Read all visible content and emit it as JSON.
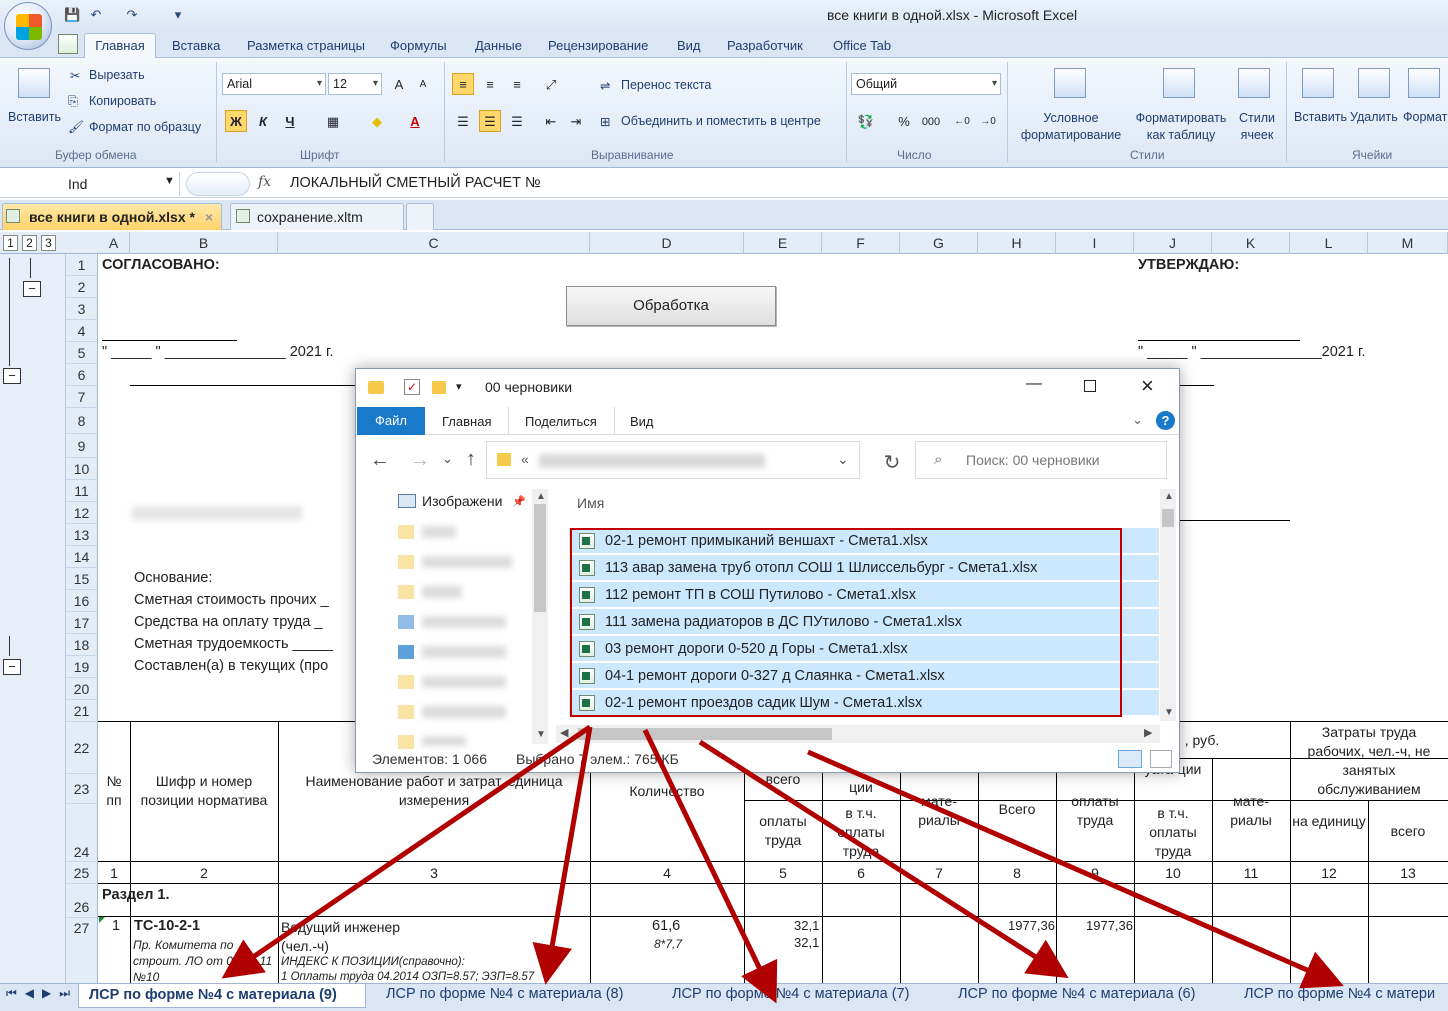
{
  "window_title": "все книги в одной.xlsx - Microsoft Excel",
  "ribbon_tabs": [
    "Главная",
    "Вставка",
    "Разметка страницы",
    "Формулы",
    "Данные",
    "Рецензирование",
    "Вид",
    "Разработчик",
    "Office Tab"
  ],
  "clipboard": {
    "paste": "Вставить",
    "cut": "Вырезать",
    "copy": "Копировать",
    "format_painter": "Формат по образцу",
    "label": "Буфер обмена"
  },
  "font": {
    "name": "Arial",
    "size": "12",
    "bold": "Ж",
    "italic": "К",
    "underline": "Ч",
    "label": "Шрифт"
  },
  "alignment": {
    "wrap": "Перенос текста",
    "merge": "Объединить и поместить в центре",
    "label": "Выравнивание"
  },
  "number": {
    "format": "Общий",
    "percent": "%",
    "thousands": "000",
    "label": "Число"
  },
  "styles": {
    "conditional": "Условное форматирование",
    "as_table": "Форматировать как таблицу",
    "cell_styles": "Стили ячеек",
    "label": "Стили"
  },
  "cells": {
    "insert": "Вставить",
    "delete": "Удалить",
    "format": "Формат",
    "label": "Ячейки"
  },
  "name_box": "Ind",
  "formula": "ЛОКАЛЬНЫЙ СМЕТНЫЙ РАСЧЕТ №",
  "workbook_tabs": [
    "все книги в одной.xlsx *",
    "сохранение.xltm"
  ],
  "columns": [
    "A",
    "B",
    "C",
    "D",
    "E",
    "F",
    "G",
    "H",
    "I",
    "J",
    "K",
    "L",
    "M"
  ],
  "outline_levels": [
    "1",
    "2",
    "3"
  ],
  "rows": [
    "1",
    "2",
    "3",
    "4",
    "5",
    "6",
    "7",
    "8",
    "9",
    "10",
    "11",
    "12",
    "13",
    "14",
    "15",
    "16",
    "17",
    "18",
    "19",
    "20",
    "21",
    "22",
    "23",
    "24",
    "25",
    "26",
    "27"
  ],
  "sheet": {
    "agreed": "СОГЛАСОВАНО:",
    "approve": "УТВЕРЖДАЮ:",
    "button": "Обработка",
    "date_left": "\" _____ \" _______________ 2021 г.",
    "date_right": "\" _____ \" _______________2021 г.",
    "basis": "Основание:",
    "cost_other": "Сметная стоимость прочих _",
    "labor_funds": "Средства на оплату труда _",
    "labor_intensity": "Сметная трудоемкость _____",
    "compiled": "Составлен(а) в текущих (про",
    "hdr_no": "№ пп",
    "hdr_code": "Шифр и номер позиции норматива",
    "hdr_name": "Наименование работ и затрат, единица измерения",
    "hdr_qty": "Количество",
    "hdr_total": "всего",
    "hdr_pay": "оплаты труда",
    "hdr_expl": "ции",
    "hdr_incl_pay": "в т.ч. оплаты труда",
    "hdr_mat": "мате-риалы",
    "hdr_all": "Всего",
    "hdr_pay2": "оплаты труда",
    "hdr_expl2": "уата-ции",
    "hdr_incl_pay2": "в т.ч. оплаты труда",
    "hdr_mat2": "мате-риалы",
    "hdr_rub": ", руб.",
    "hdr_labor": "Затраты труда рабочих, чел.-ч, не занятых обслуживанием",
    "hdr_unit": "на единицу",
    "hdr_all2": "всего",
    "col_nums": [
      "1",
      "2",
      "3",
      "4",
      "5",
      "6",
      "7",
      "8",
      "9",
      "10",
      "11",
      "12",
      "13"
    ],
    "section": "Раздел 1.",
    "r27_no": "1",
    "r27_code": "ТС-10-2-1",
    "r27_code_note": "Пр. Комитета по строит. ЛО от 01.07.11 №10",
    "r27_name": "Ведущий инженер (чел.-ч)",
    "r27_index": "ИНДЕКС К ПОЗИЦИИ(справочно):",
    "r27_index2": "1 Оплаты труда 04.2014 ОЗП=8.57; ЭЗП=8.57",
    "r27_qty": "61,6",
    "r27_qty2": "8*7,7",
    "r27_e1": "32,1",
    "r27_e2": "32,1",
    "r27_h": "1977,36",
    "r27_i": "1977,36"
  },
  "sheet_tabs": [
    "ЛСР по форме №4 с материала (9)",
    "ЛСР по форме №4 с материала (8)",
    "ЛСР по форме №4 с материала (7)",
    "ЛСР по форме №4 с материала (6)",
    "ЛСР по форме №4 с матери"
  ],
  "explorer": {
    "title": "00 черновики",
    "tabs": [
      "Файл",
      "Главная",
      "Поделиться",
      "Вид"
    ],
    "address_sep": "«",
    "search_placeholder": "Поиск: 00 черновики",
    "column_name": "Имя",
    "nav_first": "Изображени",
    "files": [
      "02-1 ремонт примыканий веншахт - Смета1.xlsx",
      "113 авар замена труб отопл СОШ 1 Шлиссельбург - Смета1.xlsx",
      "112 ремонт ТП в СОШ Путилово - Смета1.xlsx",
      "111 замена радиаторов в ДС ПУтилово - Смета1.xlsx",
      "03 ремонт дороги 0-520 д Горы - Смета1.xlsx",
      "04-1 ремонт дороги 0-327 д Слаянка - Смета1.xlsx",
      "02-1 ремонт проездов садик Шум - Смета1.xlsx"
    ],
    "status_count": "Элементов: 1 066",
    "status_selected": "Выбрано 7 элем.: 765 КБ"
  },
  "colors": {
    "selection": "#cce8ff",
    "red_box": "#c00000",
    "arrow": "#b00000",
    "file_tab": "#1979ca"
  }
}
